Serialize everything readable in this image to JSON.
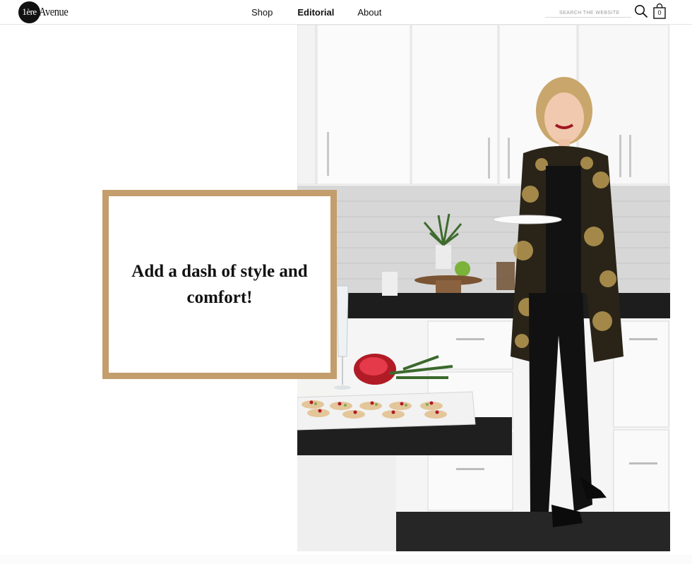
{
  "header": {
    "logo": {
      "circle_text": "1ère",
      "word": "Avenue"
    },
    "nav": [
      {
        "label": "Shop",
        "active": false
      },
      {
        "label": "Editorial",
        "active": true
      },
      {
        "label": "About",
        "active": false
      }
    ],
    "search": {
      "placeholder": "SEARCH THE WEBSITE",
      "value": "",
      "icon": "search-icon"
    },
    "cart": {
      "count": "0",
      "icon": "shopping-bag-icon"
    }
  },
  "hero": {
    "image_subject": "woman in gold floral lace jacket holding plate in white kitchen with appetizer tray"
  },
  "callout": {
    "text": "Add a dash of style and comfort!",
    "border_color": "#c49d6c"
  },
  "colors": {
    "accent": "#c49d6c",
    "text": "#111111",
    "divider": "#e4e4e4"
  }
}
